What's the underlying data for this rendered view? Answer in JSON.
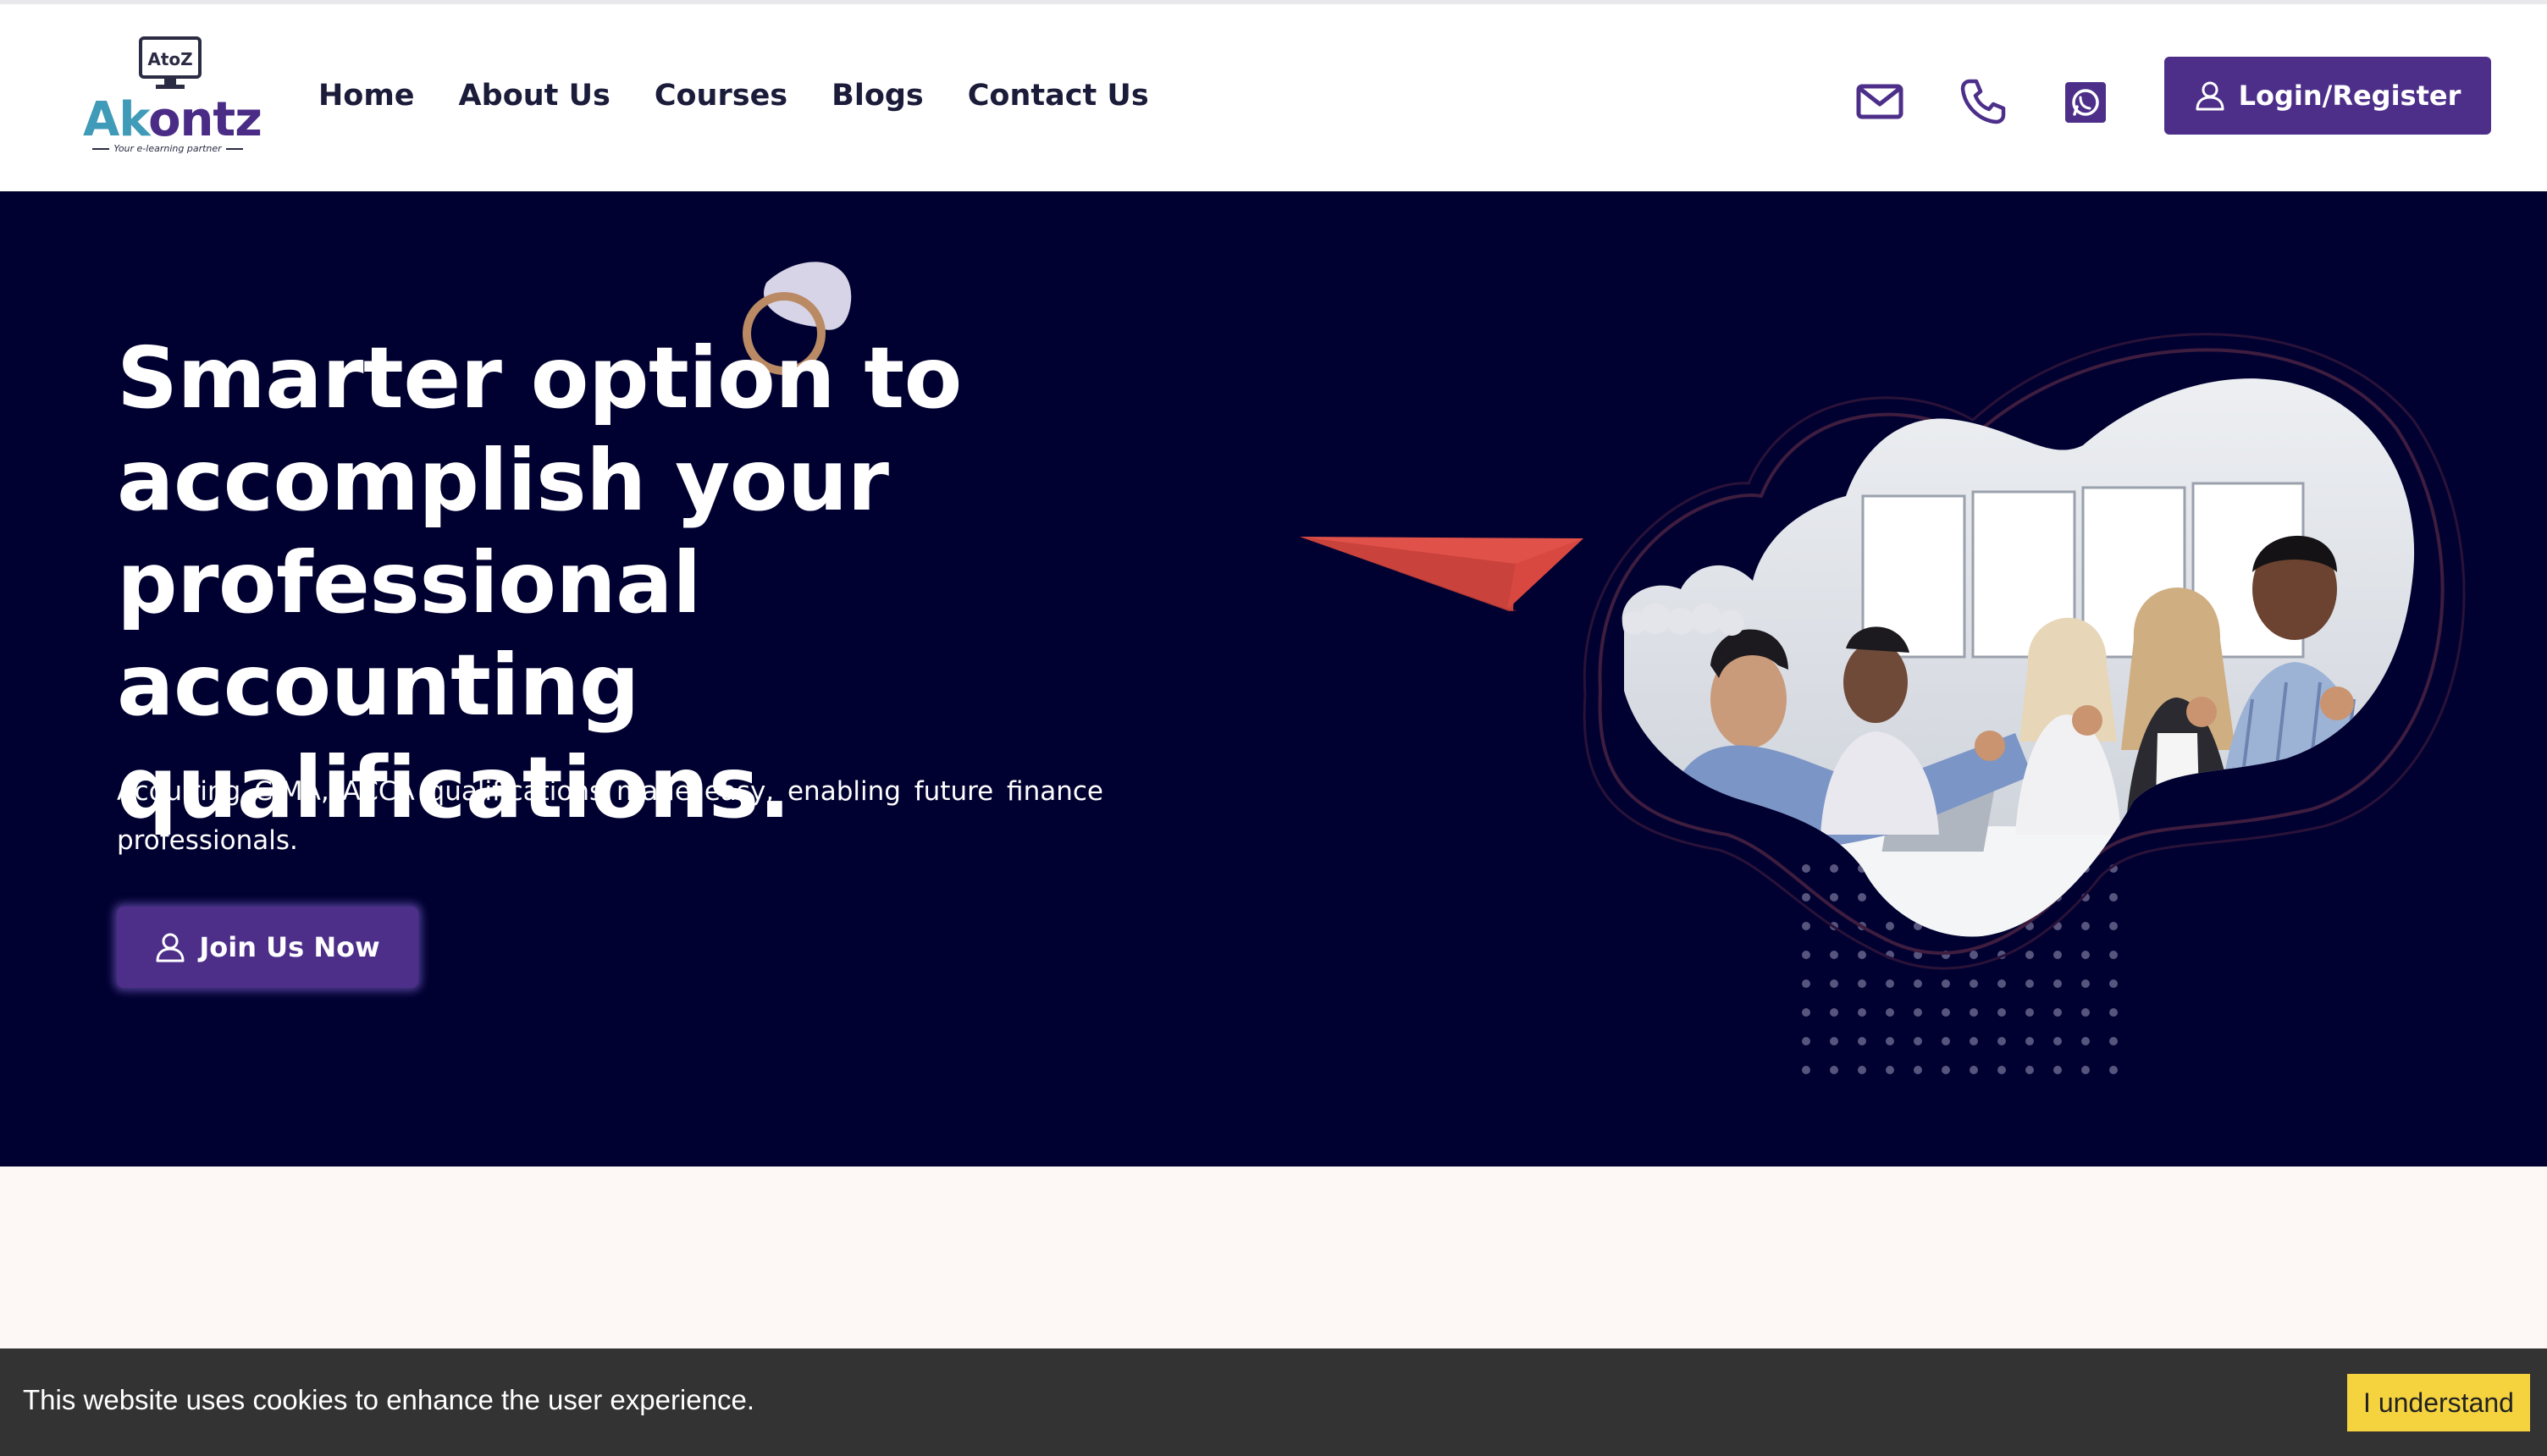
{
  "brand": {
    "logo_badge": "AtoZ",
    "logo_word_part1": "Ak",
    "logo_word_part2": "ontz",
    "tagline": "Your e-learning partner"
  },
  "nav": {
    "items": [
      {
        "label": "Home"
      },
      {
        "label": "About Us"
      },
      {
        "label": "Courses"
      },
      {
        "label": "Blogs"
      },
      {
        "label": "Contact Us"
      }
    ]
  },
  "header_icons": [
    "mail-icon",
    "phone-icon",
    "whatsapp-icon"
  ],
  "login_button": {
    "label": "Login/Register",
    "icon": "user-icon"
  },
  "hero": {
    "title": "Smarter option to accomplish your professional accounting qualifications.",
    "subtitle": "Acquiring CIMA, ACCA qualifications made easy, enabling future finance professionals.",
    "cta_label": "Join Us Now",
    "cta_icon": "user-icon"
  },
  "cookie_bar": {
    "message": "This website uses cookies to enhance the user experience.",
    "button_label": "I understand"
  },
  "colors": {
    "primary": "#4d2f8a",
    "hero_bg": "#010131",
    "logo_teal": "#3f9bb8",
    "cookie_bg": "#333333",
    "cookie_button": "#f5d33e",
    "below_bg": "#fdf7f6"
  }
}
